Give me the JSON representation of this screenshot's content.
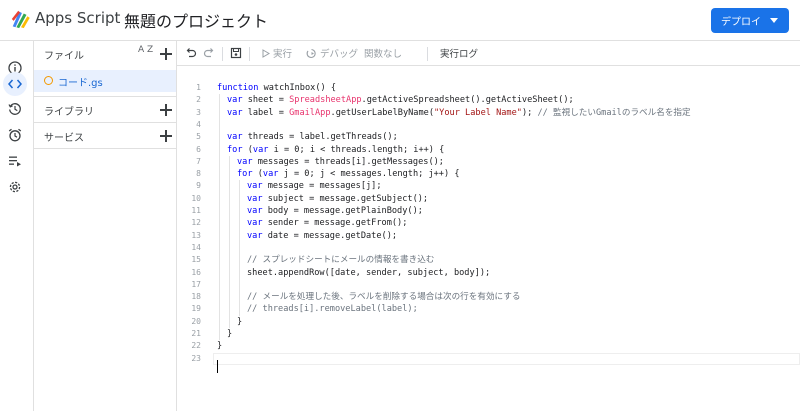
{
  "header": {
    "app_name": "Apps Script",
    "project_title": "無題のプロジェクト",
    "deploy_label": "デプロイ",
    "brand_color": "#1a73e8"
  },
  "rail": {
    "icons": [
      "info-icon",
      "code-icon",
      "history-icon",
      "alarm-icon",
      "executions-icon",
      "settings-icon"
    ],
    "active": "code-icon"
  },
  "files": {
    "header_label": "ファイル",
    "sort_label": "A Z",
    "file_name": "コード.gs",
    "libraries_label": "ライブラリ",
    "services_label": "サービス"
  },
  "toolbar": {
    "run_label": "実行",
    "debug_label": "デバッグ",
    "function_label": "関数なし",
    "log_label": "実行ログ"
  },
  "editor": {
    "lines": [
      {
        "n": "1",
        "indent": 0,
        "html": "<span class='kw'>function</span> watchInbox() {"
      },
      {
        "n": "2",
        "indent": 1,
        "html": "<span class='kw'>var</span> sheet = <span class='cls'>SpreadsheetApp</span>.getActiveSpreadsheet().getActiveSheet();"
      },
      {
        "n": "3",
        "indent": 1,
        "html": "<span class='kw'>var</span> label = <span class='cls'>GmailApp</span>.getUserLabelByName(<span class='str'>\"Your Label Name\"</span>); <span class='cmt'>// 監視したいGmailのラベル名を指定</span>"
      },
      {
        "n": "4",
        "indent": 0,
        "html": ""
      },
      {
        "n": "5",
        "indent": 1,
        "html": "<span class='kw'>var</span> threads = label.getThreads();"
      },
      {
        "n": "6",
        "indent": 1,
        "html": "<span class='kw'>for</span> (<span class='kw'>var</span> i = 0; i &lt; threads.length; i++) {"
      },
      {
        "n": "7",
        "indent": 2,
        "html": "<span class='kw'>var</span> messages = threads[i].getMessages();"
      },
      {
        "n": "8",
        "indent": 2,
        "html": "<span class='kw'>for</span> (<span class='kw'>var</span> j = 0; j &lt; messages.length; j++) {"
      },
      {
        "n": "9",
        "indent": 3,
        "html": "<span class='kw'>var</span> message = messages[j];"
      },
      {
        "n": "10",
        "indent": 3,
        "html": "<span class='kw'>var</span> subject = message.getSubject();"
      },
      {
        "n": "11",
        "indent": 3,
        "html": "<span class='kw'>var</span> body = message.getPlainBody();"
      },
      {
        "n": "12",
        "indent": 3,
        "html": "<span class='kw'>var</span> sender = message.getFrom();"
      },
      {
        "n": "13",
        "indent": 3,
        "html": "<span class='kw'>var</span> date = message.getDate();"
      },
      {
        "n": "14",
        "indent": 0,
        "html": ""
      },
      {
        "n": "15",
        "indent": 3,
        "html": "<span class='cmt'>// スプレッドシートにメールの情報を書き込む</span>"
      },
      {
        "n": "16",
        "indent": 3,
        "html": "sheet.appendRow([date, sender, subject, body]);"
      },
      {
        "n": "17",
        "indent": 0,
        "html": ""
      },
      {
        "n": "18",
        "indent": 3,
        "html": "<span class='cmt'>// メールを処理した後、ラベルを削除する場合は次の行を有効にする</span>"
      },
      {
        "n": "19",
        "indent": 3,
        "html": "<span class='cmt'>// threads[i].removeLabel(label);</span>"
      },
      {
        "n": "20",
        "indent": 2,
        "html": "}"
      },
      {
        "n": "21",
        "indent": 1,
        "html": "}"
      },
      {
        "n": "22",
        "indent": 0,
        "html": "}"
      },
      {
        "n": "23",
        "indent": 0,
        "html": ""
      }
    ]
  }
}
